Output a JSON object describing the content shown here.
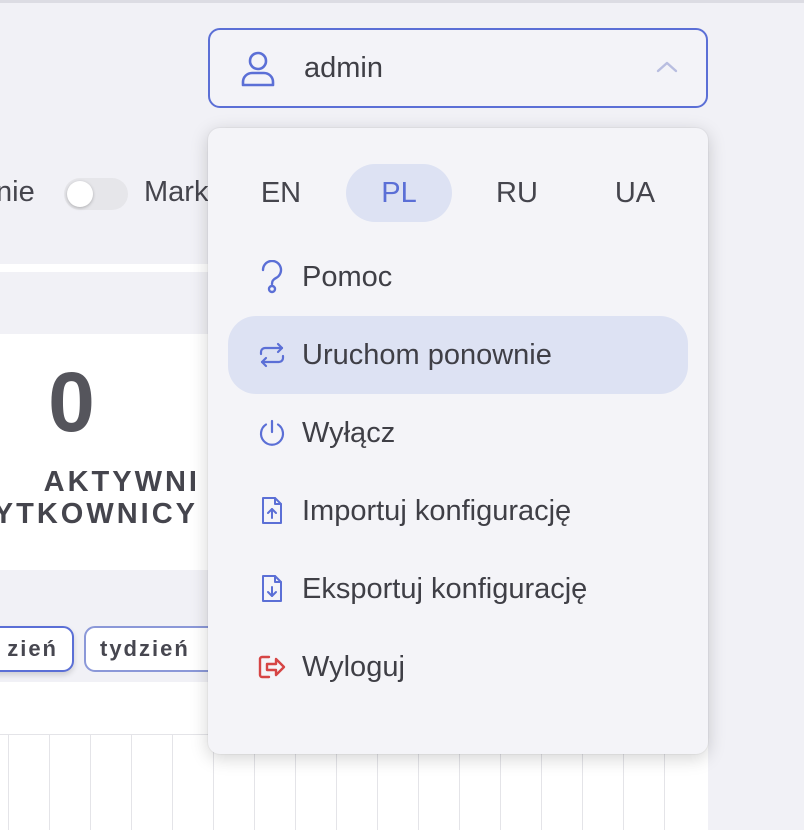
{
  "header": {
    "user_name": "admin"
  },
  "background": {
    "toggle_label_left": "nie",
    "toggle_label_right": "Mark",
    "stat_value": "0",
    "stat_label_line1": "AKTYWNI",
    "stat_label_line2": "YTKOWNICY",
    "period_day": "zień",
    "period_week": "tydzień"
  },
  "menu": {
    "languages": [
      {
        "code": "EN",
        "active": false
      },
      {
        "code": "PL",
        "active": true
      },
      {
        "code": "RU",
        "active": false
      },
      {
        "code": "UA",
        "active": false
      }
    ],
    "items": [
      {
        "label": "Pomoc",
        "icon": "help-icon"
      },
      {
        "label": "Uruchom ponownie",
        "icon": "restart-icon",
        "highlighted": true
      },
      {
        "label": "Wyłącz",
        "icon": "power-icon"
      },
      {
        "label": "Importuj konfigurację",
        "icon": "file-import-icon"
      },
      {
        "label": "Eksportuj konfigurację",
        "icon": "file-export-icon"
      },
      {
        "label": "Wyloguj",
        "icon": "logout-icon"
      }
    ]
  },
  "colors": {
    "accent": "#5b6fd6",
    "highlight": "#dde2f3",
    "logout": "#d64545",
    "text": "#3f3f46"
  }
}
